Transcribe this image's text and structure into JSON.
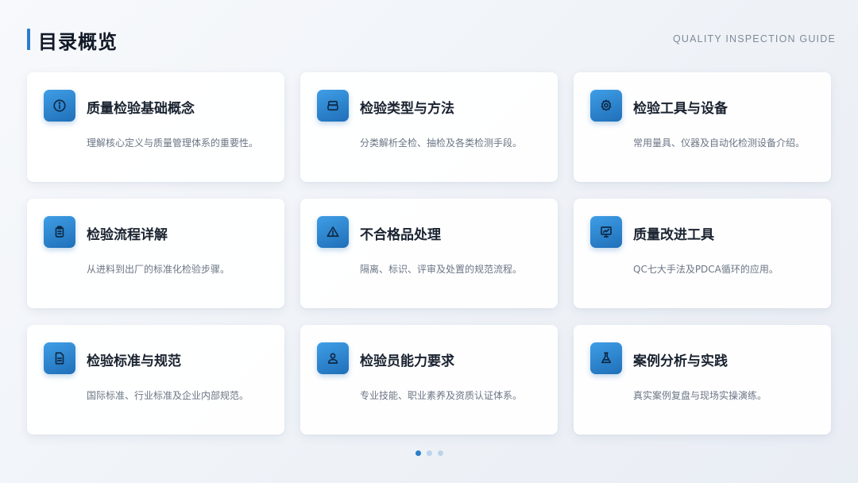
{
  "header": {
    "title": "目录概览",
    "subtitle": "QUALITY INSPECTION GUIDE"
  },
  "cards": [
    {
      "icon": "info-icon",
      "title": "质量检验基础概念",
      "desc": "理解核心定义与质量管理体系的重要性。"
    },
    {
      "icon": "layers-icon",
      "title": "检验类型与方法",
      "desc": "分类解析全检、抽检及各类检测手段。"
    },
    {
      "icon": "gear-icon",
      "title": "检验工具与设备",
      "desc": "常用量具、仪器及自动化检测设备介绍。"
    },
    {
      "icon": "clipboard-icon",
      "title": "检验流程详解",
      "desc": "从进料到出厂的标准化检验步骤。"
    },
    {
      "icon": "warning-icon",
      "title": "不合格品处理",
      "desc": "隔离、标识、评审及处置的规范流程。"
    },
    {
      "icon": "presentation-chart-icon",
      "title": "质量改进工具",
      "desc": "QC七大手法及PDCA循环的应用。"
    },
    {
      "icon": "document-icon",
      "title": "检验标准与规范",
      "desc": "国际标准、行业标准及企业内部规范。"
    },
    {
      "icon": "user-icon",
      "title": "检验员能力要求",
      "desc": "专业技能、职业素养及资质认证体系。"
    },
    {
      "icon": "flask-icon",
      "title": "案例分析与实践",
      "desc": "真实案例复盘与现场实操演练。"
    }
  ],
  "pagination": {
    "total": 3,
    "current": 1
  },
  "colors": {
    "accent": "#2a7fc9",
    "icon_gradient_top": "#3f9ee6",
    "icon_gradient_bottom": "#1f6fb8"
  }
}
